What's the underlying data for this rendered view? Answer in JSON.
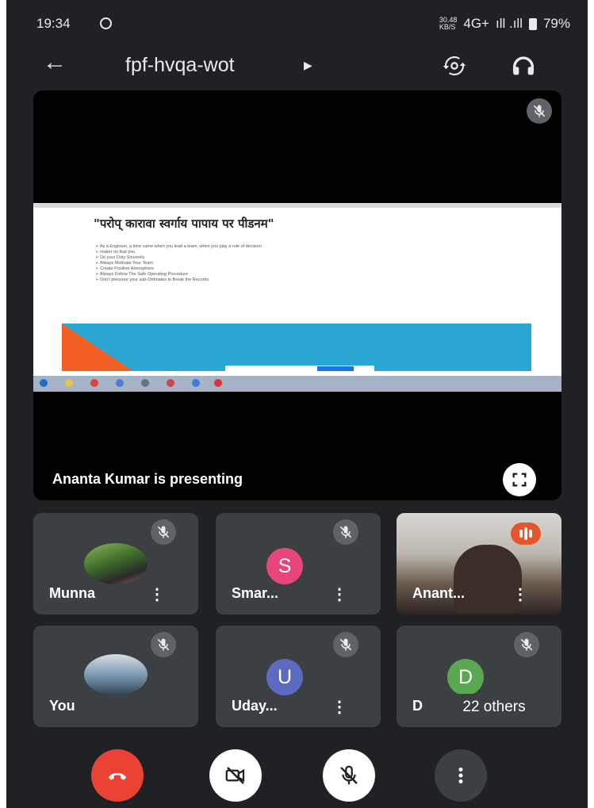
{
  "status_bar": {
    "time": "19:34",
    "speed_value": "30.48",
    "speed_unit": "KB/S",
    "network": "4G+",
    "signal": "ıll .ıll",
    "battery": "79%"
  },
  "top_bar": {
    "meeting_code": "fpf-hvqa-wot"
  },
  "presentation": {
    "slide_heading": "\"परोप् कारावा स्वर्गाय पापाय पर पीडनम\"",
    "slide_bullets": [
      "As a Engineer, a time came when you lead a team, when you play a role of decision",
      "maker on that you",
      "Do your Duty Sincerely",
      "Always Motivate Your Team",
      "Create Positive Atmosphere",
      "Always Follow The Safe Operating Procedure",
      "Don't pressure your sub-Ordinates to Break the Records"
    ],
    "presenter_label": "Ananta Kumar is presenting"
  },
  "participants": [
    {
      "name": "Munna",
      "avatar": "photo",
      "muted": true
    },
    {
      "name": "Smar...",
      "avatar_letter": "S",
      "avatar_color": "#e8457a",
      "muted": true
    },
    {
      "name": "Anant...",
      "avatar": "video",
      "speaking": true
    },
    {
      "name": "You",
      "avatar": "photo",
      "muted": true
    },
    {
      "name": "Uday...",
      "avatar_letter": "U",
      "avatar_color": "#5c6bc0",
      "muted": true
    },
    {
      "name": "D",
      "avatar_letter": "D",
      "avatar_color": "#5aa84f",
      "muted": true
    }
  ],
  "others_chip": "22 others",
  "controls": {
    "end_call_color": "#ea4335",
    "items": [
      "end-call-icon",
      "camera-off-icon",
      "mic-off-icon",
      "more-vert-icon"
    ]
  }
}
